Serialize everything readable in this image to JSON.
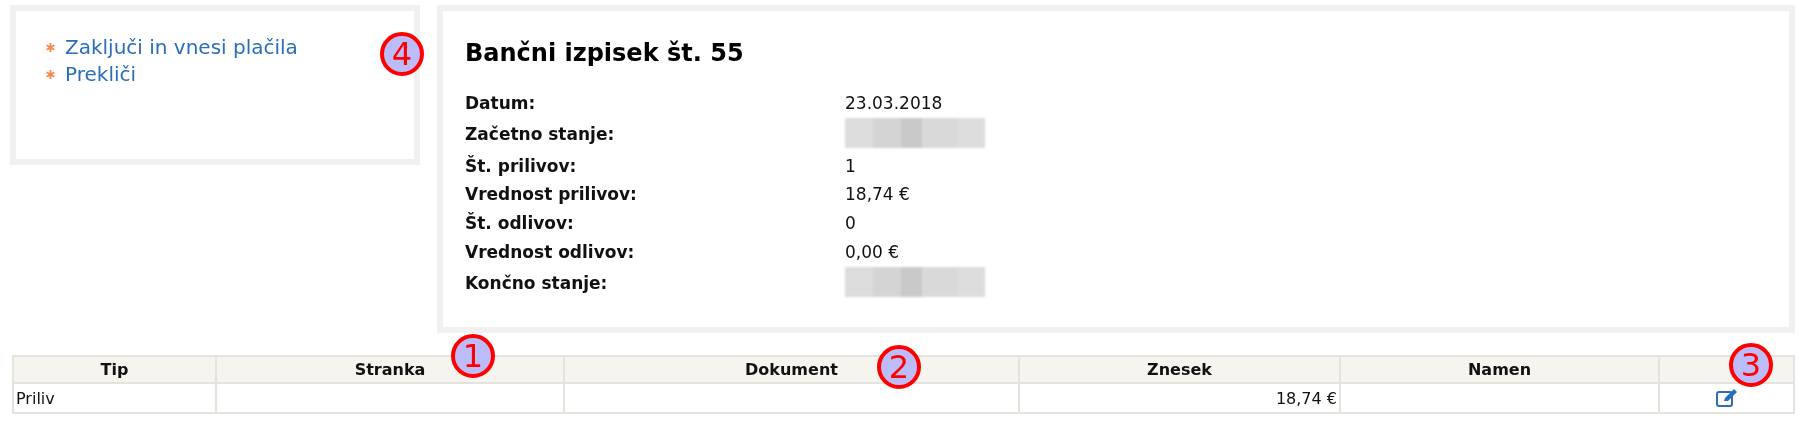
{
  "actions": [
    {
      "label": "Zaključi in vnesi plačila"
    },
    {
      "label": "Prekliči"
    }
  ],
  "statement": {
    "title": "Bančni izpisek št. 55",
    "fields": [
      {
        "label": "Datum:",
        "kind": "text",
        "value": "23.03.2018"
      },
      {
        "label": "Začetno stanje:",
        "kind": "redacted"
      },
      {
        "label": "Št. prilivov:",
        "kind": "text",
        "value": "1"
      },
      {
        "label": "Vrednost prilivov:",
        "kind": "text",
        "value": "18,74 €"
      },
      {
        "label": "Št. odlivov:",
        "kind": "text",
        "value": "0"
      },
      {
        "label": "Vrednost odlivov:",
        "kind": "text",
        "value": "0,00 €"
      },
      {
        "label": "Končno stanje:",
        "kind": "redacted"
      }
    ]
  },
  "table": {
    "columns": [
      "Tip",
      "Stranka",
      "Dokument",
      "Znesek",
      "Namen"
    ],
    "rows": [
      {
        "cells": [
          "Priliv",
          "",
          "",
          "18,74 €",
          ""
        ],
        "editable": true
      }
    ]
  },
  "callouts": [
    {
      "number": "4"
    },
    {
      "number": "1"
    },
    {
      "number": "2"
    },
    {
      "number": "3"
    }
  ]
}
